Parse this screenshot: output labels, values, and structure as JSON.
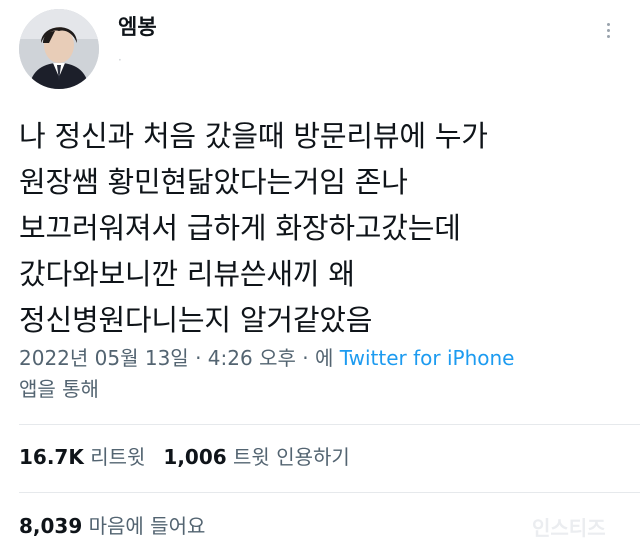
{
  "user": {
    "display_name": "엠봉",
    "handle": "·",
    "avatar_icon": "profile-photo"
  },
  "tweet": {
    "lines": [
      "나 정신과 처음 갔을때 방문리뷰에 누가",
      "원장쌤 황민현닮았다는거임 존나",
      "보끄러워져서 급하게 화장하고갔는데",
      "갔다와보니깐 리뷰쓴새끼 왜",
      "정신병원다니는지 알거같았음"
    ]
  },
  "meta": {
    "date": "2022년 05월 13일",
    "separator": " · ",
    "time": "4:26 오후",
    "via_prefix": "에",
    "source": "Twitter for iPhone",
    "via_suffix": "앱을 통해"
  },
  "stats": {
    "retweets_count": "16.7K",
    "retweets_label": "리트윗",
    "quotes_count": "1,006",
    "quotes_label": "트윗 인용하기",
    "likes_count": "8,039",
    "likes_label": "마음에 들어요"
  },
  "watermark": "인스티즈",
  "colors": {
    "text": "#0f1419",
    "secondary": "#536471",
    "link": "#1d9bf0",
    "divider": "#e6e9ec"
  }
}
